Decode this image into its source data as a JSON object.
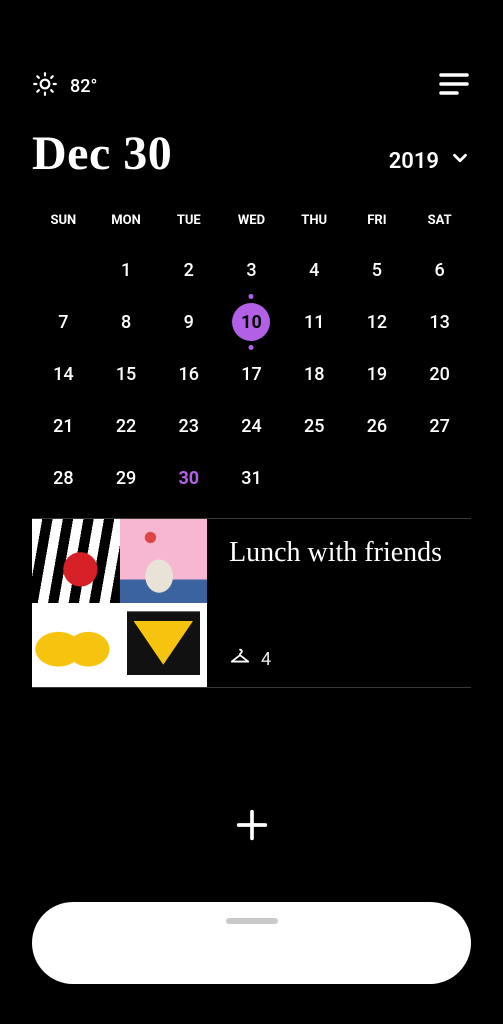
{
  "colors": {
    "accent": "#B261E6"
  },
  "weather": {
    "temp": "82°",
    "icon": "sun-icon"
  },
  "header": {
    "current_date": "Dec 30",
    "year": "2019"
  },
  "calendar": {
    "dow": [
      "SUN",
      "MON",
      "TUE",
      "WED",
      "THU",
      "FRI",
      "SAT"
    ],
    "leading_blanks": 1,
    "days": 31,
    "circled_day": 10,
    "highlighted_day": 30
  },
  "events": [
    {
      "title": "Lunch with friends",
      "items_count": "4"
    }
  ]
}
